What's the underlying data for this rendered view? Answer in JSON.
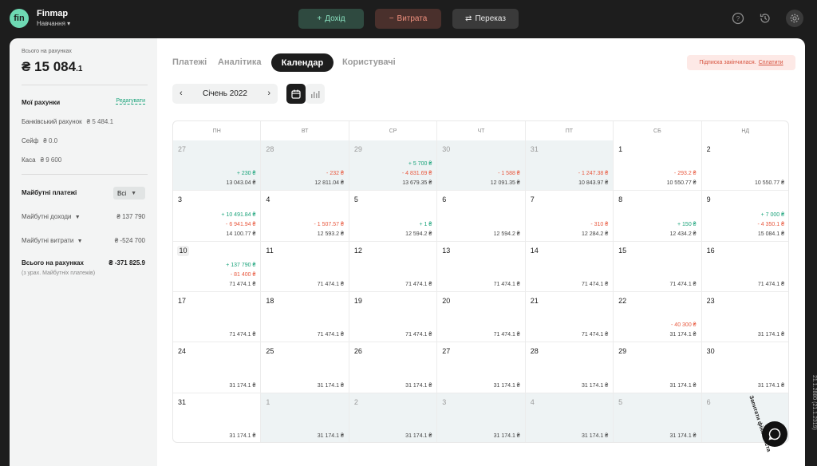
{
  "app": {
    "logo": "fin",
    "name": "Finmap",
    "workspace": "Навчання"
  },
  "top_actions": {
    "income": "Дохід",
    "expense": "Витрата",
    "transfer": "Переказ"
  },
  "top_icons": [
    "help-icon",
    "history-icon",
    "settings-icon"
  ],
  "sidebar": {
    "total_caption": "Всього на рахунках",
    "total_main": "₴ 15 084",
    "total_fraction": ".1",
    "accounts_title": "Мої рахунки",
    "edit_label": "Редагувати",
    "accounts": [
      {
        "name": "Банківський рахунок",
        "value": "₴ 5 484.1"
      },
      {
        "name": "Сейф",
        "value": "₴ 0.0"
      },
      {
        "name": "Каса",
        "value": "₴ 9 600"
      }
    ],
    "future_title": "Майбутні платежі",
    "future_filter": "Всі",
    "future_income_label": "Майбутні доходи",
    "future_income_value": "₴ 137 790",
    "future_expense_label": "Майбутні витрати",
    "future_expense_value": "₴ -524 700",
    "grand_total_label": "Всього на рахунках",
    "grand_total_value": "₴ -371 825.9",
    "grand_total_note": "(з урах. Майбутніх платежів)"
  },
  "tabs": [
    {
      "label": "Платежі",
      "active": false
    },
    {
      "label": "Аналітика",
      "active": false
    },
    {
      "label": "Календар",
      "active": true
    },
    {
      "label": "Користувачі",
      "active": false
    }
  ],
  "subscription_notice": {
    "text": "Підписка закінчилася.",
    "link": "Сплатити"
  },
  "month_nav": {
    "prev": "‹",
    "label": "Січень 2022",
    "next": "›"
  },
  "view_toggle": {
    "active": "calendar"
  },
  "weekdays": [
    "ПН",
    "ВТ",
    "СР",
    "ЧТ",
    "ПТ",
    "СБ",
    "НД"
  ],
  "calendar": [
    [
      {
        "day": "27",
        "other": true,
        "income": "+ 230 ₴",
        "expense": "",
        "balance": "13 043.04 ₴"
      },
      {
        "day": "28",
        "other": true,
        "income": "",
        "expense": "- 232 ₴",
        "balance": "12 811.04 ₴"
      },
      {
        "day": "29",
        "other": true,
        "income": "+ 5 700 ₴",
        "expense": "- 4 831.69 ₴",
        "balance": "13 679.35 ₴"
      },
      {
        "day": "30",
        "other": true,
        "income": "",
        "expense": "- 1 588 ₴",
        "balance": "12 091.35 ₴"
      },
      {
        "day": "31",
        "other": true,
        "income": "",
        "expense": "- 1 247.38 ₴",
        "balance": "10 843.97 ₴"
      },
      {
        "day": "1",
        "other": false,
        "income": "",
        "expense": "- 293.2 ₴",
        "balance": "10 550.77 ₴"
      },
      {
        "day": "2",
        "other": false,
        "income": "",
        "expense": "",
        "balance": "10 550.77 ₴"
      }
    ],
    [
      {
        "day": "3",
        "other": false,
        "income": "+ 10 491.84 ₴",
        "expense": "- 6 941.94 ₴",
        "balance": "14 100.77 ₴"
      },
      {
        "day": "4",
        "other": false,
        "income": "",
        "expense": "- 1 507.57 ₴",
        "balance": "12 593.2 ₴"
      },
      {
        "day": "5",
        "other": false,
        "income": "+ 1 ₴",
        "expense": "",
        "balance": "12 594.2 ₴"
      },
      {
        "day": "6",
        "other": false,
        "income": "",
        "expense": "",
        "balance": "12 594.2 ₴"
      },
      {
        "day": "7",
        "other": false,
        "income": "",
        "expense": "- 310 ₴",
        "balance": "12 284.2 ₴"
      },
      {
        "day": "8",
        "other": false,
        "income": "+ 150 ₴",
        "expense": "",
        "balance": "12 434.2 ₴"
      },
      {
        "day": "9",
        "other": false,
        "income": "+ 7 000 ₴",
        "expense": "- 4 350.1 ₴",
        "balance": "15 084.1 ₴"
      }
    ],
    [
      {
        "day": "10",
        "other": false,
        "today": true,
        "income": "+ 137 790 ₴",
        "expense": "- 81 400 ₴",
        "balance": "71 474.1 ₴"
      },
      {
        "day": "11",
        "other": false,
        "income": "",
        "expense": "",
        "balance": "71 474.1 ₴"
      },
      {
        "day": "12",
        "other": false,
        "income": "",
        "expense": "",
        "balance": "71 474.1 ₴"
      },
      {
        "day": "13",
        "other": false,
        "income": "",
        "expense": "",
        "balance": "71 474.1 ₴"
      },
      {
        "day": "14",
        "other": false,
        "income": "",
        "expense": "",
        "balance": "71 474.1 ₴"
      },
      {
        "day": "15",
        "other": false,
        "income": "",
        "expense": "",
        "balance": "71 474.1 ₴"
      },
      {
        "day": "16",
        "other": false,
        "income": "",
        "expense": "",
        "balance": "71 474.1 ₴"
      }
    ],
    [
      {
        "day": "17",
        "other": false,
        "income": "",
        "expense": "",
        "balance": "71 474.1 ₴"
      },
      {
        "day": "18",
        "other": false,
        "income": "",
        "expense": "",
        "balance": "71 474.1 ₴"
      },
      {
        "day": "19",
        "other": false,
        "income": "",
        "expense": "",
        "balance": "71 474.1 ₴"
      },
      {
        "day": "20",
        "other": false,
        "income": "",
        "expense": "",
        "balance": "71 474.1 ₴"
      },
      {
        "day": "21",
        "other": false,
        "income": "",
        "expense": "",
        "balance": "71 474.1 ₴"
      },
      {
        "day": "22",
        "other": false,
        "income": "",
        "expense": "- 40 300 ₴",
        "balance": "31 174.1 ₴"
      },
      {
        "day": "23",
        "other": false,
        "income": "",
        "expense": "",
        "balance": "31 174.1 ₴"
      }
    ],
    [
      {
        "day": "24",
        "other": false,
        "income": "",
        "expense": "",
        "balance": "31 174.1 ₴"
      },
      {
        "day": "25",
        "other": false,
        "income": "",
        "expense": "",
        "balance": "31 174.1 ₴"
      },
      {
        "day": "26",
        "other": false,
        "income": "",
        "expense": "",
        "balance": "31 174.1 ₴"
      },
      {
        "day": "27",
        "other": false,
        "income": "",
        "expense": "",
        "balance": "31 174.1 ₴"
      },
      {
        "day": "28",
        "other": false,
        "income": "",
        "expense": "",
        "balance": "31 174.1 ₴"
      },
      {
        "day": "29",
        "other": false,
        "income": "",
        "expense": "",
        "balance": "31 174.1 ₴"
      },
      {
        "day": "30",
        "other": false,
        "income": "",
        "expense": "",
        "balance": "31 174.1 ₴"
      }
    ],
    [
      {
        "day": "31",
        "other": false,
        "income": "",
        "expense": "",
        "balance": "31 174.1 ₴"
      },
      {
        "day": "1",
        "other": true,
        "income": "",
        "expense": "",
        "balance": "31 174.1 ₴"
      },
      {
        "day": "2",
        "other": true,
        "income": "",
        "expense": "",
        "balance": "31 174.1 ₴"
      },
      {
        "day": "3",
        "other": true,
        "income": "",
        "expense": "",
        "balance": "31 174.1 ₴"
      },
      {
        "day": "4",
        "other": true,
        "income": "",
        "expense": "",
        "balance": "31 174.1 ₴"
      },
      {
        "day": "5",
        "other": true,
        "income": "",
        "expense": "",
        "balance": "31 174.1 ₴"
      },
      {
        "day": "6",
        "other": true,
        "income": "",
        "expense": "",
        "balance": ""
      }
    ]
  ],
  "side_labels": {
    "version": "21.1.2880 (21.1.2319)",
    "ask": "Запитати фінансиста"
  },
  "colors": {
    "accent": "#6ed9b3",
    "income": "#1aa37a",
    "expense": "#e8593f",
    "dark": "#1d1d1d"
  }
}
